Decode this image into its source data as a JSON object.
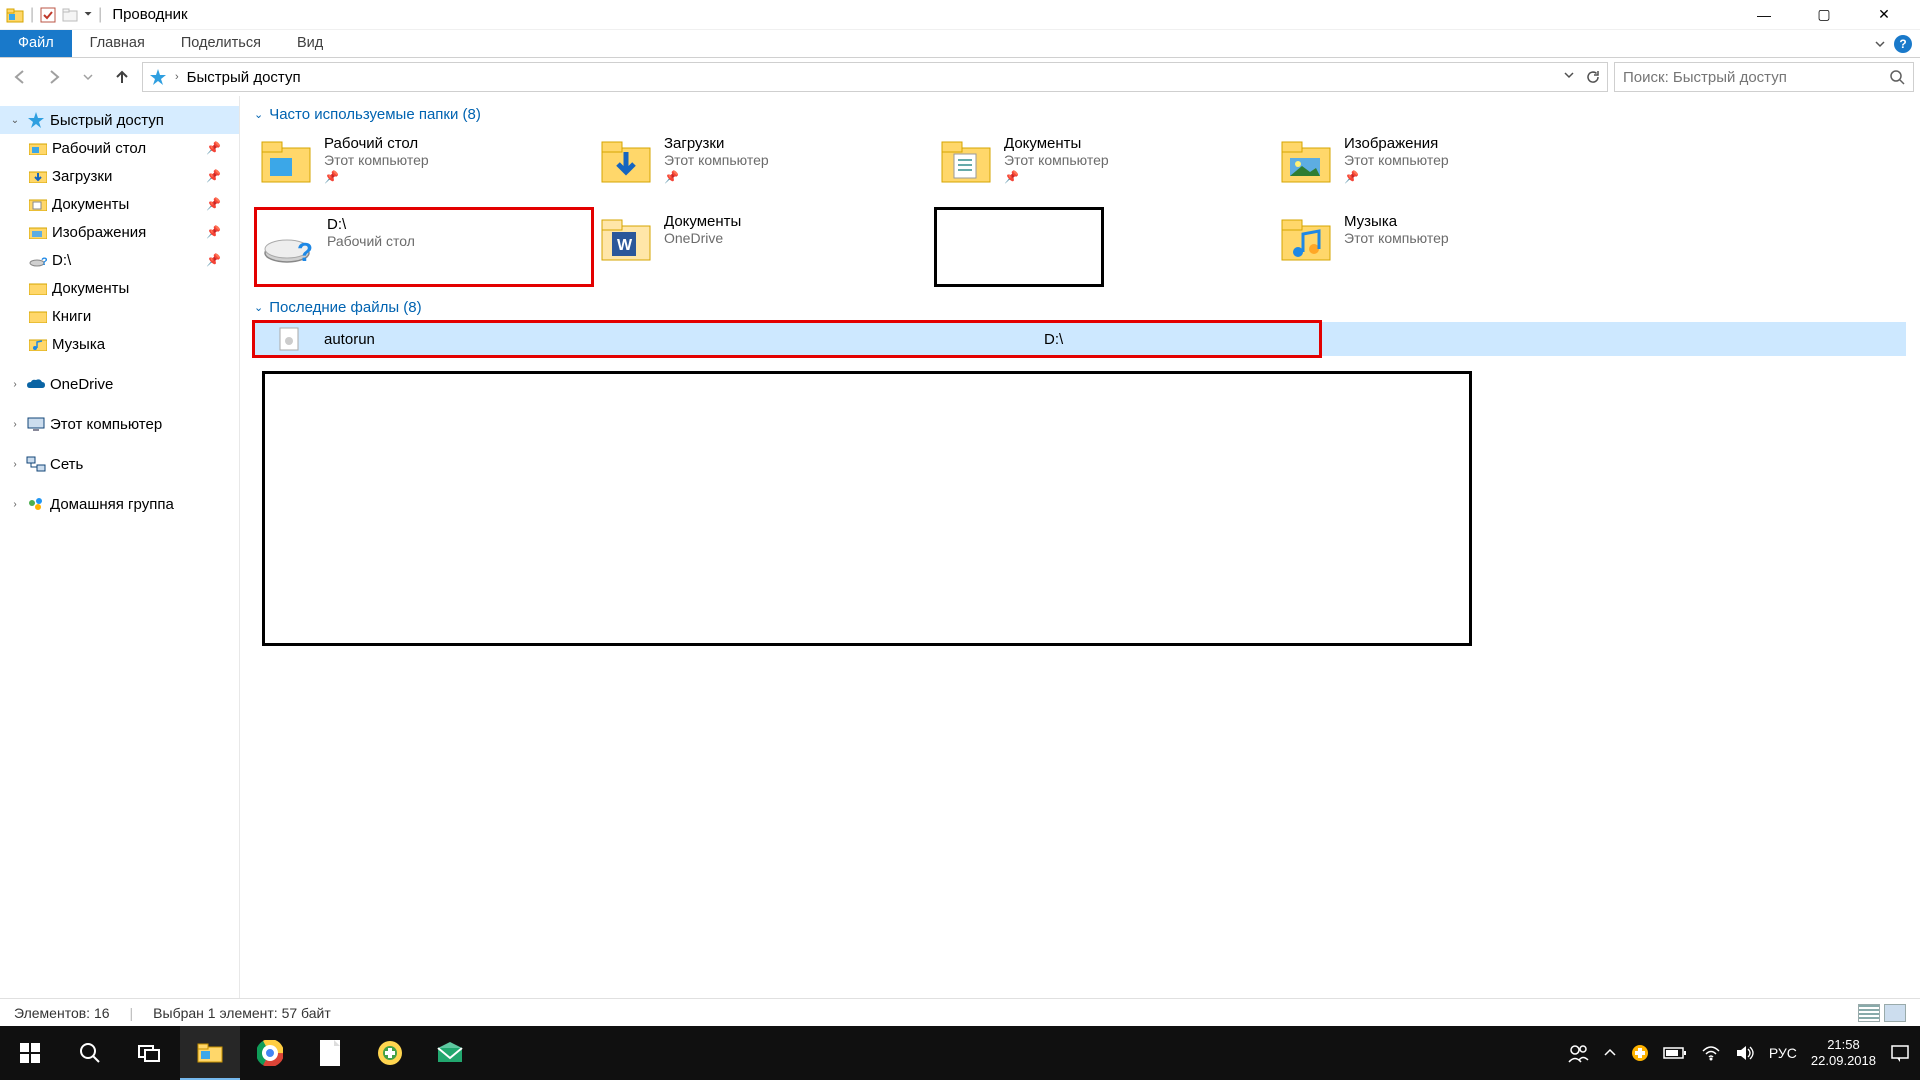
{
  "window": {
    "title": "Проводник",
    "controls": {
      "minimize": "—",
      "maximize": "▢",
      "close": "✕"
    }
  },
  "ribbon": {
    "file": "Файл",
    "tabs": [
      "Главная",
      "Поделиться",
      "Вид"
    ],
    "help": "?"
  },
  "nav": {
    "crumb_root": "Быстрый доступ",
    "search_placeholder": "Поиск: Быстрый доступ"
  },
  "sidebar": {
    "quick_access": "Быстрый доступ",
    "pinned": [
      {
        "label": "Рабочий стол",
        "icon": "desktop"
      },
      {
        "label": "Загрузки",
        "icon": "downloads"
      },
      {
        "label": "Документы",
        "icon": "documents"
      },
      {
        "label": "Изображения",
        "icon": "pictures"
      },
      {
        "label": "D:\\",
        "icon": "drive-q"
      }
    ],
    "recent": [
      {
        "label": "Документы",
        "icon": "folder"
      },
      {
        "label": "Книги",
        "icon": "folder"
      },
      {
        "label": "Музыка",
        "icon": "music"
      }
    ],
    "roots": [
      {
        "label": "OneDrive",
        "icon": "onedrive"
      },
      {
        "label": "Этот компьютер",
        "icon": "thispc"
      },
      {
        "label": "Сеть",
        "icon": "network"
      },
      {
        "label": "Домашняя группа",
        "icon": "homegroup"
      }
    ]
  },
  "content": {
    "section_folders": "Часто используемые папки (8)",
    "section_files": "Последние файлы (8)",
    "folders": [
      {
        "name": "Рабочий стол",
        "sub": "Этот компьютер",
        "pinned": true,
        "icon": "desktop-big"
      },
      {
        "name": "Загрузки",
        "sub": "Этот компьютер",
        "pinned": true,
        "icon": "downloads-big"
      },
      {
        "name": "Документы",
        "sub": "Этот компьютер",
        "pinned": true,
        "icon": "documents-big"
      },
      {
        "name": "Изображения",
        "sub": "Этот компьютер",
        "pinned": true,
        "icon": "pictures-big"
      },
      {
        "name": "D:\\",
        "sub": "Рабочий стол",
        "pinned": false,
        "icon": "drive-q-big",
        "highlight": "red"
      },
      {
        "name": "Документы",
        "sub": "OneDrive",
        "pinned": false,
        "icon": "word-folder"
      },
      {
        "name": "",
        "sub": "",
        "pinned": false,
        "icon": "",
        "highlight": "black-empty"
      },
      {
        "name": "Музыка",
        "sub": "Этот компьютер",
        "pinned": false,
        "icon": "music-big"
      }
    ],
    "files": [
      {
        "name": "autorun",
        "path": "D:\\",
        "selected": true,
        "highlight": "red"
      }
    ]
  },
  "statusbar": {
    "count": "Элементов: 16",
    "selection": "Выбран 1 элемент: 57 байт"
  },
  "taskbar": {
    "lang": "РУС",
    "time": "21:58",
    "date": "22.09.2018"
  }
}
